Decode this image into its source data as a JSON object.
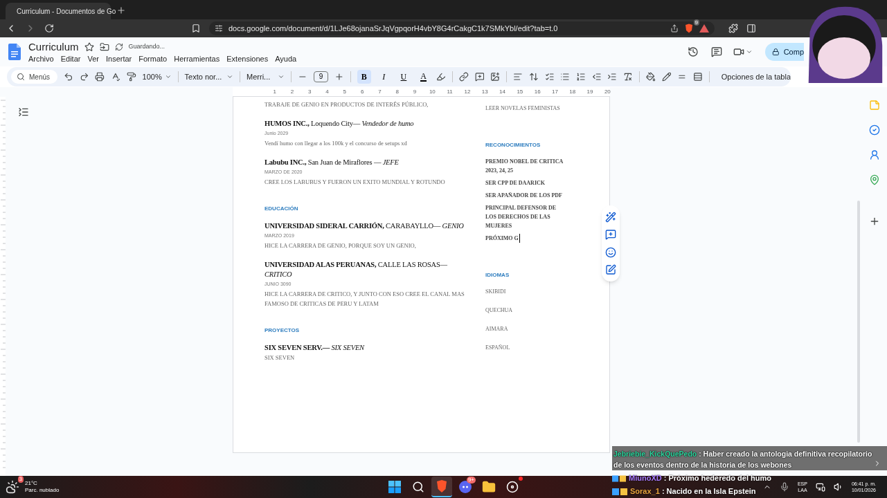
{
  "browser": {
    "tab_title": "Curriculum - Documentos de Go",
    "url": "docs.google.com/document/d/1LJe68ojanaSrJqVgpqorH4vbY8G4rCakgC1k7SMkYbl/edit?tab=t.0",
    "shield_badge": "9"
  },
  "doc_header": {
    "title": "Curriculum",
    "save_status": "Guardando...",
    "menus": [
      "Archivo",
      "Editar",
      "Ver",
      "Insertar",
      "Formato",
      "Herramientas",
      "Extensiones",
      "Ayuda"
    ],
    "share_label": "Comp"
  },
  "toolbar": {
    "search_label": "Menús",
    "zoom": "100%",
    "style": "Texto nor...",
    "font": "Merri...",
    "font_size": "9",
    "format_buttons": [
      {
        "label": "B",
        "selected": true
      },
      {
        "label": "I",
        "selected": false
      },
      {
        "label": "U",
        "selected": false
      },
      {
        "label": "A",
        "selected": false
      }
    ],
    "table_options": "Opciones de la tabla"
  },
  "ruler": [
    "1",
    "2",
    "3",
    "4",
    "5",
    "6",
    "7",
    "8",
    "9",
    "10",
    "11",
    "12",
    "13",
    "14",
    "15",
    "16",
    "17",
    "18",
    "19",
    "20"
  ],
  "document": {
    "left_column": [
      {
        "kind": "text",
        "text": "TRABAJE DE GENIO EN PRODUCTOS DE INTERÉS PÚBLICO,"
      },
      {
        "kind": "entry",
        "org": "HUMOS INC.,",
        "place": "Loquendo City—",
        "role": "Vendedor de humo",
        "date": "Junio 2029",
        "lines": [
          "Vendí humo con llegar a los 100k y el concurso de setups xd"
        ]
      },
      {
        "kind": "entry",
        "org": "Labubu INC.,",
        "place": "San Juan de Miraflores —",
        "role": "JEFE",
        "date": "MARZO DE 2020",
        "lines": [
          "CREE LOS LABUBUS Y FUERON UN EXITO MUNDIAL Y ROTUNDO"
        ]
      },
      {
        "kind": "section",
        "text": "EDUCACIÓN"
      },
      {
        "kind": "entry",
        "org": "UNIVERSIDAD SIDERAL CARRIÓN,",
        "place": "CARABAYLLO—",
        "role": "GENIO",
        "date": "MARZO 2019",
        "lines": [
          "HICE LA CARRERA DE GENIO, PORQUE SOY UN GENIO,"
        ]
      },
      {
        "kind": "entry",
        "org": "UNIVERSIDAD ALAS PERUANAS,",
        "place": "CALLE LAS ROSAS—",
        "role": "CRITICO",
        "date": "JUNIO 3090",
        "lines": [
          "HICE LA CARRERA DE CRITICO, Y JUNTO CON ESO CREE EL CANAL MAS",
          "FAMOSO DE CRITICAS DE PERU Y LATAM"
        ]
      },
      {
        "kind": "section",
        "text": "PROYECTOS"
      },
      {
        "kind": "entry",
        "org": "SIX SEVEN SERV.—",
        "role": "SIX SEVEN",
        "lines": [
          "SIX SEVEN"
        ]
      }
    ],
    "right_column": [
      {
        "kind": "plain_list",
        "items": [
          {
            "text": "LEER NOVELAS FEMINISTAS",
            "cursor": false
          }
        ]
      },
      {
        "kind": "bold_list",
        "title": "RECONOCIMIENTOS",
        "items": [
          {
            "text": "PREMIO NOBEL DE CRITICA 2023, 24, 25",
            "cursor": false
          },
          {
            "text": "SER CPP DE DAARICK",
            "cursor": false
          },
          {
            "text": "SER APAÑADOR DE LOS PDF",
            "cursor": false
          },
          {
            "text": "PRINCIPAL DEFENSOR DE LOS DERECHOS DE LAS MUJERES",
            "cursor": false
          },
          {
            "text": "PRÓXIMO G",
            "cursor": true
          }
        ]
      },
      {
        "kind": "plain_list",
        "title": "IDIOMAS",
        "items": [
          {
            "text": "SKIBIDI",
            "cursor": false
          },
          {
            "text": "QUECHUA",
            "cursor": false
          },
          {
            "text": "AIMARA",
            "cursor": false
          },
          {
            "text": "ESPAÑOL",
            "cursor": false
          }
        ]
      }
    ]
  },
  "chat": [
    {
      "kind": "highlight",
      "user": "Jebriebie_KickQuePedo",
      "color": "#2fd8a0",
      "text": ": Haber creado la antologia definitiva recopilatorio de los eventos dentro de la historia de los webones"
    },
    {
      "kind": "plain",
      "user": "MiunoXD",
      "color": "#a77bff",
      "text": ": Próximo hederedo del humo"
    },
    {
      "kind": "plain",
      "user": "Sorax_1",
      "color": "#e8a33d",
      "text": ": Nacido en la Isla Epstein"
    }
  ],
  "taskbar": {
    "weather": {
      "temp": "21°C",
      "condition": "Parc. nublado",
      "badge": "3"
    },
    "apps": [
      {
        "kind": "start",
        "selected": false
      },
      {
        "kind": "search",
        "selected": false
      },
      {
        "kind": "browser",
        "selected": true
      },
      {
        "kind": "chat",
        "selected": false,
        "badge": "9+"
      },
      {
        "kind": "files",
        "selected": false
      },
      {
        "kind": "recorder",
        "selected": false,
        "notification": true
      }
    ],
    "tray": {
      "language": "ESP",
      "layout": "LAA",
      "time": "06:41 p. m.",
      "date": "10/01/2026"
    }
  }
}
